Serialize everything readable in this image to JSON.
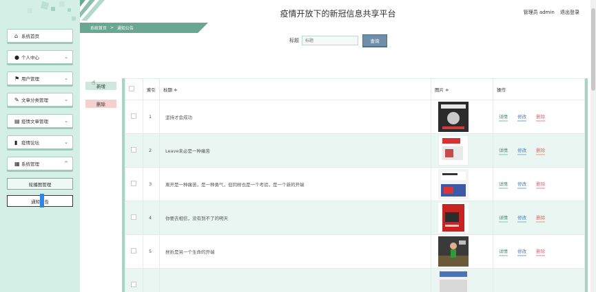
{
  "header": {
    "site_title": "疫情开放下的新冠信息共享平台",
    "user_label": "管理员 admin",
    "logout_label": "退出登录"
  },
  "breadcrumb": {
    "home": "系统首页",
    "separator": ">",
    "current": "通知公告"
  },
  "sidebar": {
    "items": [
      {
        "icon": "home-icon",
        "glyph": "⌂",
        "label": "系统首页",
        "chevron": false
      },
      {
        "icon": "user-icon",
        "glyph": "●",
        "label": "个人中心",
        "chevron": true
      },
      {
        "icon": "flag-icon",
        "glyph": "⚑",
        "label": "用户管理",
        "chevron": true
      },
      {
        "icon": "tag-icon",
        "glyph": "✎",
        "label": "文章分类管理",
        "chevron": true
      },
      {
        "icon": "box-icon",
        "glyph": "▤",
        "label": "疫情文章管理",
        "chevron": true
      },
      {
        "icon": "chart-icon",
        "glyph": "▮",
        "label": "疫情论坛",
        "chevron": true
      },
      {
        "icon": "grid-icon",
        "glyph": "▦",
        "label": "系统管理",
        "chevron": true,
        "chevron_glyph": "^"
      }
    ],
    "submenu": [
      {
        "label": "轮播图管理",
        "active": false
      },
      {
        "label": "通知公告",
        "active": true
      }
    ]
  },
  "search": {
    "label": "标题",
    "placeholder": "标题",
    "button": "查询"
  },
  "actions": {
    "add": "新增",
    "delete": "删除"
  },
  "table": {
    "headers": {
      "index": "索引",
      "title": "标题 ≑",
      "image": "图片 ≑",
      "ops": "操作"
    },
    "ops_labels": {
      "detail": "详情",
      "edit": "修改",
      "delete": "删除"
    },
    "rows": [
      {
        "index": "1",
        "title": "坚持才会成功",
        "image": "book-cover-dark"
      },
      {
        "index": "2",
        "title": "Leave未必是一种痛苦",
        "image": "book-cover-white"
      },
      {
        "index": "3",
        "title": "离开是一种痛苦，是一种勇气，但同样也是一个考验，是一个新的开端",
        "image": "book-cover-magazine"
      },
      {
        "index": "4",
        "title": "你要去相信，没有到不了的明天",
        "image": "book-cover-red"
      },
      {
        "index": "5",
        "title": "挫折是另一个生命的开端",
        "image": "photo-runner"
      },
      {
        "index": "",
        "title": "",
        "image": "book-cover-partial"
      }
    ]
  },
  "colors": {
    "accent": "#6aa792",
    "sidebar_bg": "#d4efe6",
    "row_alt": "#eaf6f2",
    "search_btn": "#6f8fa8"
  }
}
